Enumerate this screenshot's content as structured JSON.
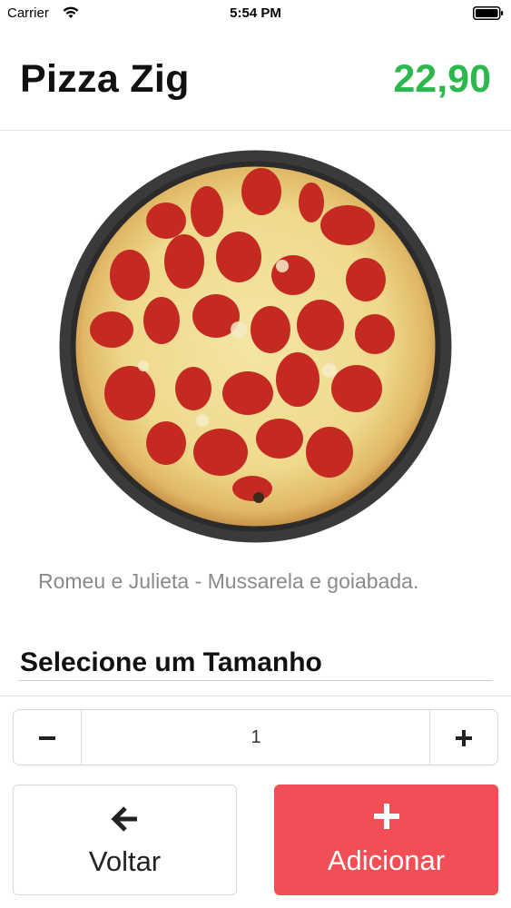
{
  "status_bar": {
    "carrier": "Carrier",
    "time": "5:54 PM",
    "icons": [
      "wifi-icon",
      "battery-icon"
    ]
  },
  "header": {
    "title": "Pizza Zig",
    "price": "22,90",
    "price_color": "#2db84d"
  },
  "product": {
    "image": "pizza-image",
    "description": "Romeu e Julieta - Mussarela e goiabada."
  },
  "size_section": {
    "title": "Selecione um Tamanho"
  },
  "quantity": {
    "value": "1",
    "decrement_icon": "minus-icon",
    "increment_icon": "plus-icon"
  },
  "actions": {
    "back_label": "Voltar",
    "back_icon": "arrow-left-icon",
    "add_label": "Adicionar",
    "add_icon": "plus-icon",
    "add_color": "#ef4f55"
  }
}
